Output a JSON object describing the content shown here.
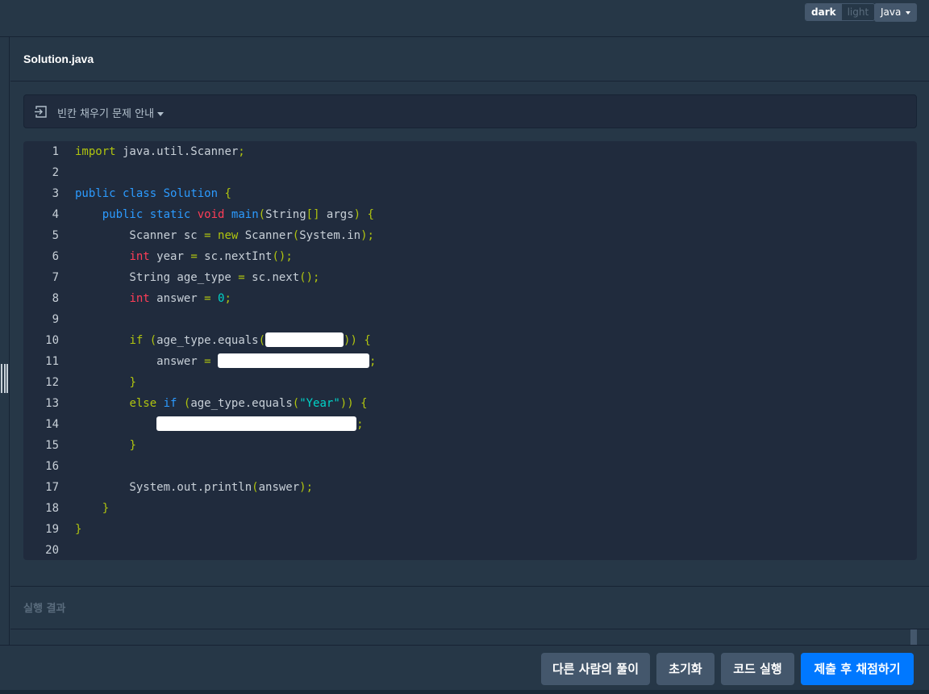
{
  "toolbar": {
    "theme_dark": "dark",
    "theme_light": "light",
    "language": "Java"
  },
  "editor": {
    "file_name": "Solution.java",
    "guide_label": "빈칸 채우기 문제 안내",
    "line_numbers": [
      "1",
      "2",
      "3",
      "4",
      "5",
      "6",
      "7",
      "8",
      "9",
      "10",
      "11",
      "12",
      "13",
      "14",
      "15",
      "16",
      "17",
      "18",
      "19",
      "20"
    ]
  },
  "result": {
    "title": "실행 결과"
  },
  "footer": {
    "others_solutions": "다른 사람의 풀이",
    "reset": "초기화",
    "run": "코드 실행",
    "submit": "제출 후 채점하기"
  },
  "colors": {
    "background": "#263747",
    "code_background": "#202b3d",
    "primary_button": "#0078ff",
    "secondary_button": "#44576c"
  }
}
